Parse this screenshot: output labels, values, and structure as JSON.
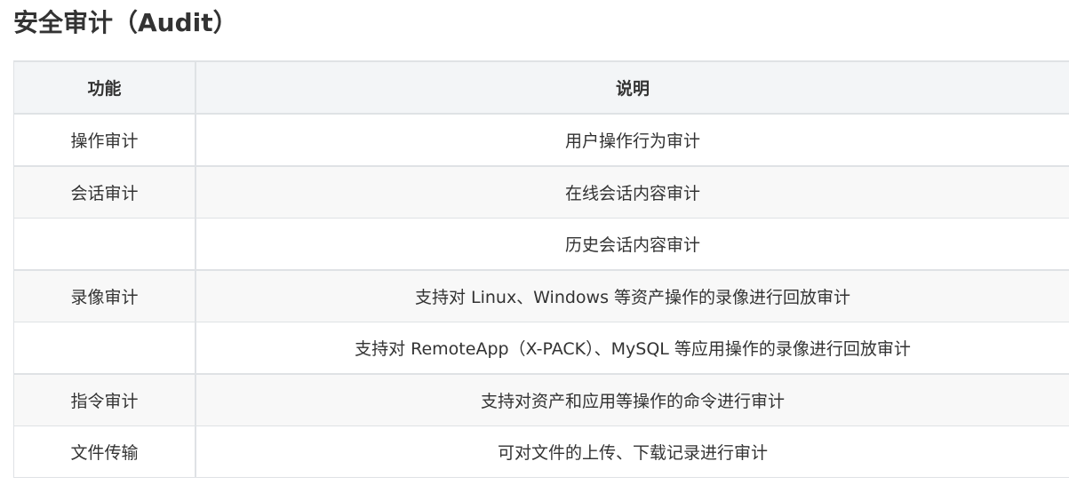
{
  "section": {
    "title": "安全审计（Audit）"
  },
  "table": {
    "headers": {
      "feature": "功能",
      "description": "说明"
    },
    "rows": [
      {
        "feature": "操作审计",
        "description": "用户操作行为审计"
      },
      {
        "feature": "会话审计",
        "description": "在线会话内容审计"
      },
      {
        "feature": "",
        "description": "历史会话内容审计"
      },
      {
        "feature": "录像审计",
        "description": "支持对 Linux、Windows 等资产操作的录像进行回放审计"
      },
      {
        "feature": "",
        "description": "支持对 RemoteApp（X-PACK）、MySQL 等应用操作的录像进行回放审计"
      },
      {
        "feature": "指令审计",
        "description": "支持对资产和应用等操作的命令进行审计"
      },
      {
        "feature": "文件传输",
        "description": "可对文件的上传、下载记录进行审计"
      }
    ]
  }
}
